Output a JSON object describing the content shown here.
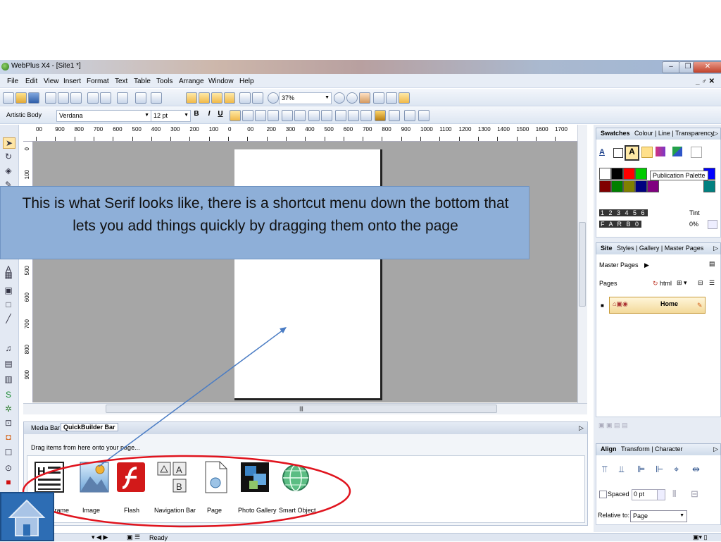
{
  "window": {
    "title": "WebPlus X4 - [Site1 *]",
    "minimize": "–",
    "restore": "❐",
    "close": "✕",
    "doc_controls": "_ ♂ ✕"
  },
  "menu": [
    {
      "label": "File"
    },
    {
      "label": "Edit"
    },
    {
      "label": "View"
    },
    {
      "label": "Insert"
    },
    {
      "label": "Format"
    },
    {
      "label": "Text"
    },
    {
      "label": "Table"
    },
    {
      "label": "Tools"
    },
    {
      "label": "Arrange"
    },
    {
      "label": "Window"
    },
    {
      "label": "Help"
    }
  ],
  "toolbar": {
    "zoom": "37%",
    "style": "Artistic Body",
    "font": "Verdana",
    "size": "12 pt",
    "bold": "B",
    "italic": "I",
    "underline": "U"
  },
  "ruler_labels": [
    "00",
    "900",
    "800",
    "700",
    "600",
    "500",
    "400",
    "300",
    "200",
    "100",
    "0",
    "00",
    "200",
    "300",
    "400",
    "500",
    "600",
    "700",
    "800",
    "900",
    "1000",
    "1100",
    "1200",
    "1300",
    "1400",
    "1500",
    "1600",
    "1700"
  ],
  "ruler_left_labels": [
    "0",
    "100",
    "500",
    "600",
    "700",
    "800",
    "900"
  ],
  "callout": {
    "text": "This is what Serif looks like, there is a shortcut menu down the bottom that lets you add things quickly by dragging them onto the page"
  },
  "bottom_panel": {
    "tabs": [
      "Media Bar",
      "QuickBuilder Bar"
    ],
    "hint": "Drag items from here onto your page...",
    "items": [
      {
        "label": "Frame"
      },
      {
        "label": "Image"
      },
      {
        "label": "Flash"
      },
      {
        "label": "Navigation Bar"
      },
      {
        "label": "Page"
      },
      {
        "label": "Photo Gallery"
      },
      {
        "label": "Smart Object"
      }
    ]
  },
  "swatches_panel": {
    "tabs": [
      "Swatches",
      "Colour",
      "Line",
      "Transparency"
    ],
    "tooltip": "Publication Palette",
    "tint_label": "Tint",
    "tint_value": "0%",
    "swatch_colors": [
      "#ffffff",
      "#000000",
      "#ff0000",
      "#00cc00",
      "#0000ff",
      "#800000",
      "#008000",
      "#808000",
      "#000080",
      "#800080",
      "#008080"
    ],
    "spot_row1": "1 2 3 4 5 6",
    "spot_row2": "F A R B 0"
  },
  "site_panel": {
    "tabs": [
      "Site",
      "Styles",
      "Gallery",
      "Master Pages"
    ],
    "master_pages": "Master Pages",
    "pages": "Pages",
    "html": "html",
    "home": "Home"
  },
  "align_panel": {
    "tabs": [
      "Align",
      "Transform",
      "Character"
    ],
    "spaced": "Spaced",
    "spacing_value": "0 pt",
    "relative_to": "Relative to:",
    "relative_value": "Page"
  },
  "status": {
    "text": "Ready"
  },
  "colors": {
    "callout_bg": "#8eafd8",
    "highlight_ellipse": "#e0141e",
    "arrow": "#4a7cc4",
    "home_button": "#2d6db4"
  }
}
